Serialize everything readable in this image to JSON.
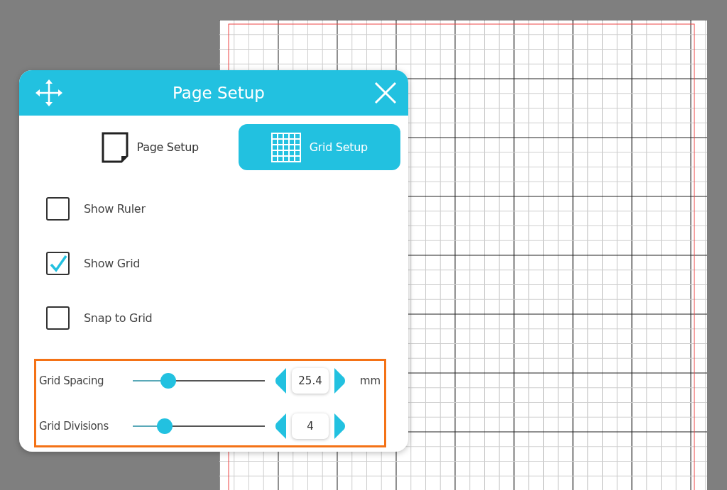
{
  "dialog": {
    "title": "Page Setup"
  },
  "tabs": [
    {
      "label": "Page Setup",
      "selected": false,
      "kind": "page"
    },
    {
      "label": "Grid Setup",
      "selected": true,
      "kind": "grid"
    }
  ],
  "options": [
    {
      "label": "Show Ruler",
      "checked": false
    },
    {
      "label": "Show Grid",
      "checked": true
    },
    {
      "label": "Snap to Grid",
      "checked": false
    }
  ],
  "settings": [
    {
      "label": "Grid Spacing",
      "level": 0.27,
      "value": "25.4",
      "unit": "mm"
    },
    {
      "label": "Grid Divisions",
      "level": 0.24,
      "value": "4"
    }
  ]
}
